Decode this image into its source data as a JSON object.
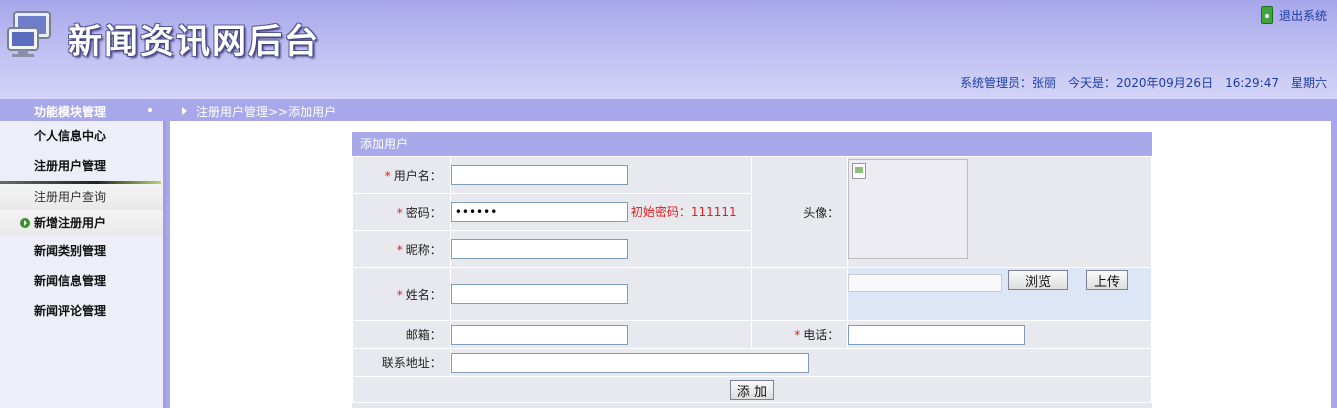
{
  "header": {
    "site_title": "新闻资讯网后台",
    "logout_label": "退出系统",
    "admin_label": "系统管理员：张丽",
    "date_label": "今天是：2020年09月26日",
    "time": "16:29:47",
    "weekday": "星期六"
  },
  "nav": {
    "sidebar_title": "功能模块管理",
    "breadcrumb": "注册用户管理>>添加用户"
  },
  "sidebar": {
    "items": [
      {
        "label": "个人信息中心"
      },
      {
        "label": "注册用户管理"
      }
    ],
    "sub_items": [
      {
        "label": "注册用户查询"
      },
      {
        "label": "新增注册用户"
      }
    ],
    "items_after": [
      {
        "label": "新闻类别管理"
      },
      {
        "label": "新闻信息管理"
      },
      {
        "label": "新闻评论管理"
      }
    ]
  },
  "form": {
    "title": "添加用户",
    "required_mark": "*",
    "username_label": "用户名：",
    "password_label": "密码：",
    "password_value": "••••••",
    "password_hint": "初始密码：111111",
    "nickname_label": "昵称：",
    "realname_label": "姓名：",
    "email_label": "邮箱：",
    "phone_label": "电话：",
    "address_label": "联系地址：",
    "avatar_label": "头像：",
    "browse_button": "浏览",
    "upload_button": "上传",
    "submit_button": "添 加"
  },
  "colors": {
    "header_gradient": "#a7a6ea",
    "accent": "#a7a7ea",
    "required": "#e02020",
    "link": "#1b3fa0"
  }
}
